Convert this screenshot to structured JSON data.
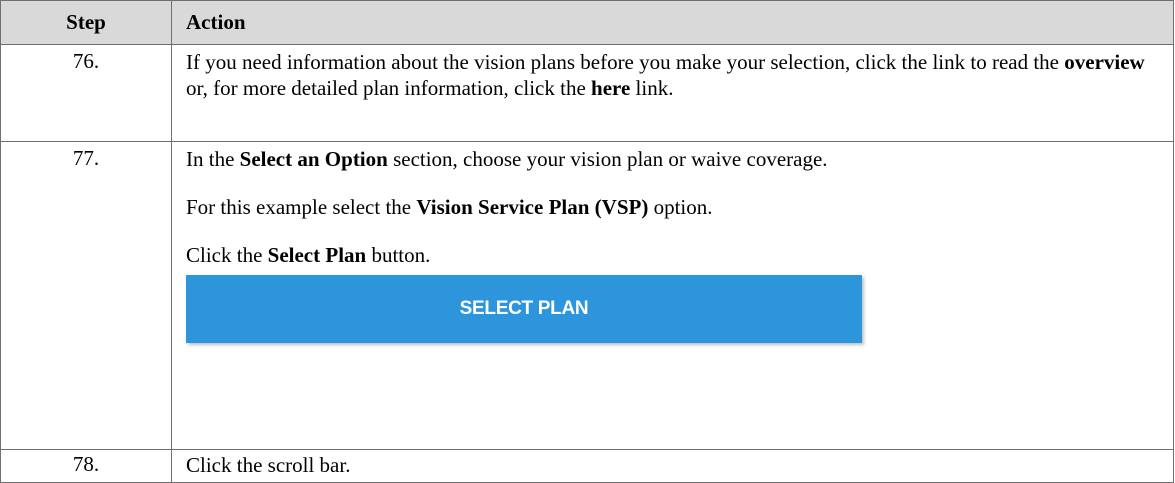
{
  "table": {
    "headers": {
      "step": "Step",
      "action": "Action"
    },
    "rows": [
      {
        "step": "76.",
        "action": {
          "t1": "If you need information about the vision plans before you make your selection, click the link to read the ",
          "b1": "overview",
          "t2": " or, for more detailed plan information, click the ",
          "b2": "here",
          "t3": " link."
        }
      },
      {
        "step": "77.",
        "action": {
          "p1_t1": "In the ",
          "p1_b1": "Select an Option",
          "p1_t2": " section, choose your vision plan or waive coverage.",
          "p2_t1": "For this example select the ",
          "p2_b1": "Vision Service Plan (VSP)",
          "p2_t2": " option.",
          "p3_t1": "Click the ",
          "p3_b1": "Select Plan",
          "p3_t2": " button.",
          "button_label": "SELECT PLAN"
        }
      },
      {
        "step": "78.",
        "action": {
          "t1": "Click the scroll bar."
        }
      }
    ]
  },
  "colors": {
    "header_bg": "#d9d9d9",
    "border": "#6f6f6f",
    "button_bg": "#2d95db",
    "button_text": "#ffffff"
  }
}
